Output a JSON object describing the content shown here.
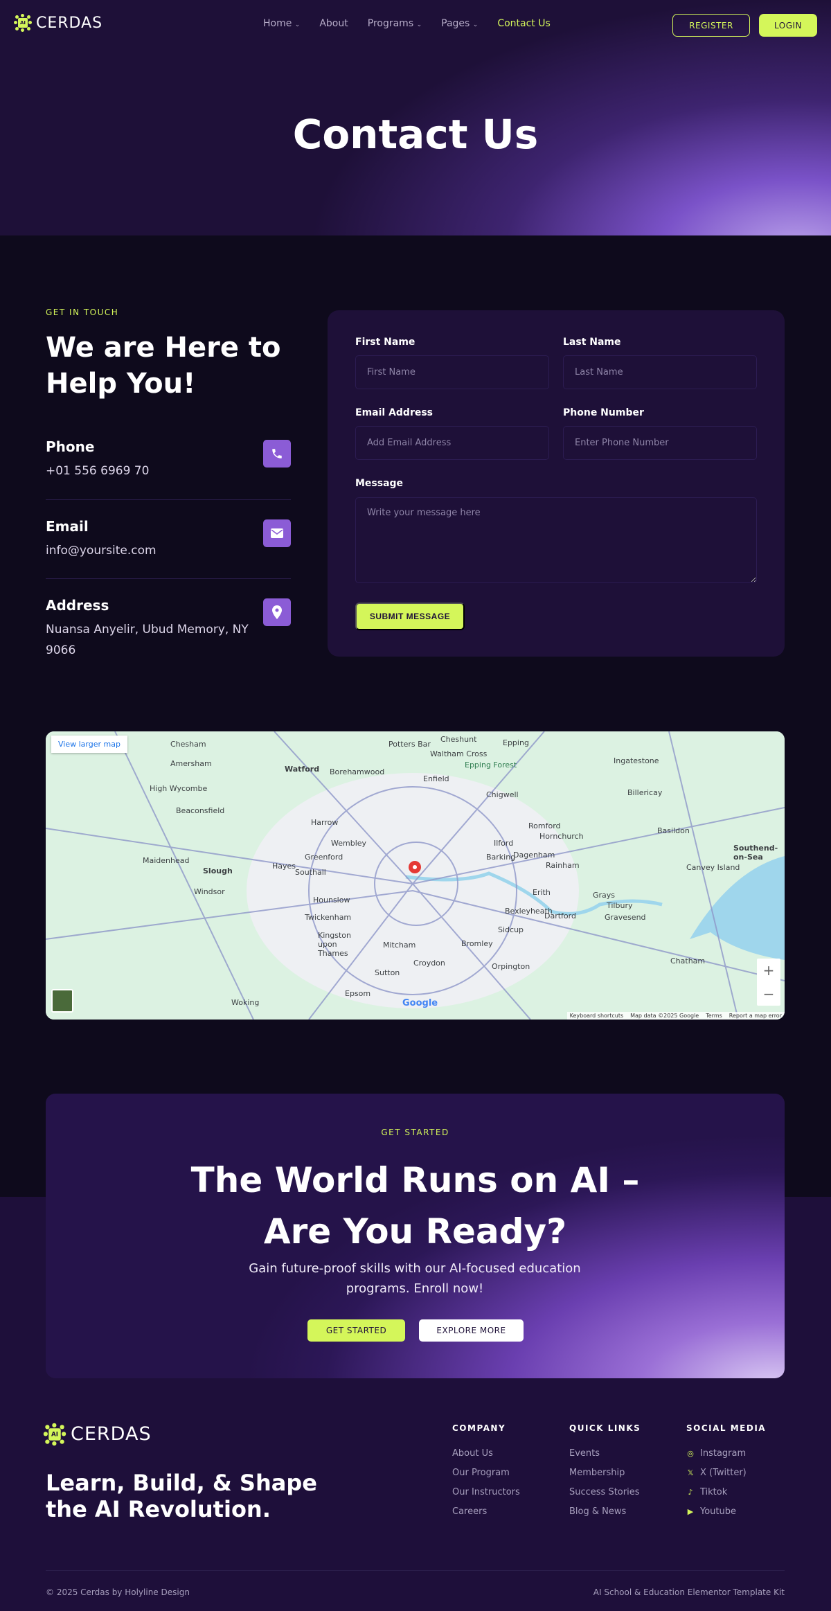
{
  "brand": {
    "name": "CERDAS",
    "mark": "AI"
  },
  "nav": {
    "items": [
      {
        "label": "Home",
        "dropdown": true
      },
      {
        "label": "About"
      },
      {
        "label": "Programs",
        "dropdown": true
      },
      {
        "label": "Pages",
        "dropdown": true
      },
      {
        "label": "Contact Us",
        "active": true
      }
    ],
    "register": "REGISTER",
    "login": "LOGIN"
  },
  "hero": {
    "title": "Contact Us"
  },
  "contact": {
    "eyebrow": "GET IN TOUCH",
    "heading_line1": "We are Here to",
    "heading_line2": "Help You!",
    "items": [
      {
        "title": "Phone",
        "value": "+01 556 6969 70",
        "icon": "phone-icon"
      },
      {
        "title": "Email",
        "value": "info@yoursite.com",
        "icon": "envelope-icon"
      },
      {
        "title": "Address",
        "value": "Nuansa Anyelir, Ubud Memory, NY 9066",
        "icon": "map-pin-icon"
      }
    ]
  },
  "form": {
    "first_name": {
      "label": "First Name",
      "placeholder": "First Name"
    },
    "last_name": {
      "label": "Last Name",
      "placeholder": "Last Name"
    },
    "email": {
      "label": "Email Address",
      "placeholder": "Add Email Address"
    },
    "phone": {
      "label": "Phone Number",
      "placeholder": "Enter Phone Number"
    },
    "message": {
      "label": "Message",
      "placeholder": "Write your message here"
    },
    "submit": "SUBMIT MESSAGE"
  },
  "map": {
    "view_larger": "View larger map",
    "places": [
      "Chesham",
      "Amersham",
      "Watford",
      "Borehamwood",
      "Potters Bar",
      "Cheshunt",
      "Epping",
      "Waltham Cross",
      "Epping Forest",
      "Enfield",
      "Ingatestone",
      "High Wycombe",
      "Beaconsfield",
      "Harrow",
      "Wembley",
      "Chigwell",
      "Romford",
      "Billericay",
      "Hornchurch",
      "Ilford",
      "Barking",
      "Dagenham",
      "Basildon",
      "Slough",
      "Hayes",
      "Southall",
      "Greenford",
      "Hounslow",
      "Windsor",
      "Maidenhead",
      "Rainham",
      "Erith",
      "Grays",
      "Tilbury",
      "Twickenham",
      "Bexleyheath",
      "Dartford",
      "Gravesend",
      "Kingston upon Thames",
      "Mitcham",
      "Bromley",
      "Sidcup",
      "Croydon",
      "Sutton",
      "Epsom",
      "Orpington",
      "Chatham",
      "Woking",
      "Southend-on-Sea",
      "Canvey Island"
    ],
    "footer": [
      "Keyboard shortcuts",
      "Map data ©2025 Google",
      "Terms",
      "Report a map error"
    ],
    "google": "Google"
  },
  "cta": {
    "eyebrow": "GET STARTED",
    "title_line1": "The World Runs on AI –",
    "title_line2": "Are You Ready?",
    "subtitle": "Gain future-proof skills with our AI-focused education programs. Enroll now!",
    "primary": "GET STARTED",
    "secondary": "EXPLORE MORE"
  },
  "footer": {
    "tagline_line1": "Learn, Build, & Shape",
    "tagline_line2": "the AI Revolution.",
    "columns": [
      {
        "title": "COMPANY",
        "links": [
          "About Us",
          "Our Program",
          "Our Instructors",
          "Careers"
        ]
      },
      {
        "title": "QUICK LINKS",
        "links": [
          "Events",
          "Membership",
          "Success Stories",
          "Blog & News"
        ]
      },
      {
        "title": "SOCIAL MEDIA",
        "links": [
          "Instagram",
          "X (Twitter)",
          "Tiktok",
          "Youtube"
        ]
      }
    ],
    "copyright": "© 2025 Cerdas by Holyline Design",
    "kit": "AI School & Education Elementor Template Kit"
  },
  "colors": {
    "accent": "#d4f65a",
    "purple": "#8b5cd6",
    "bg": "#0e0a1c",
    "card": "#1e1038"
  }
}
